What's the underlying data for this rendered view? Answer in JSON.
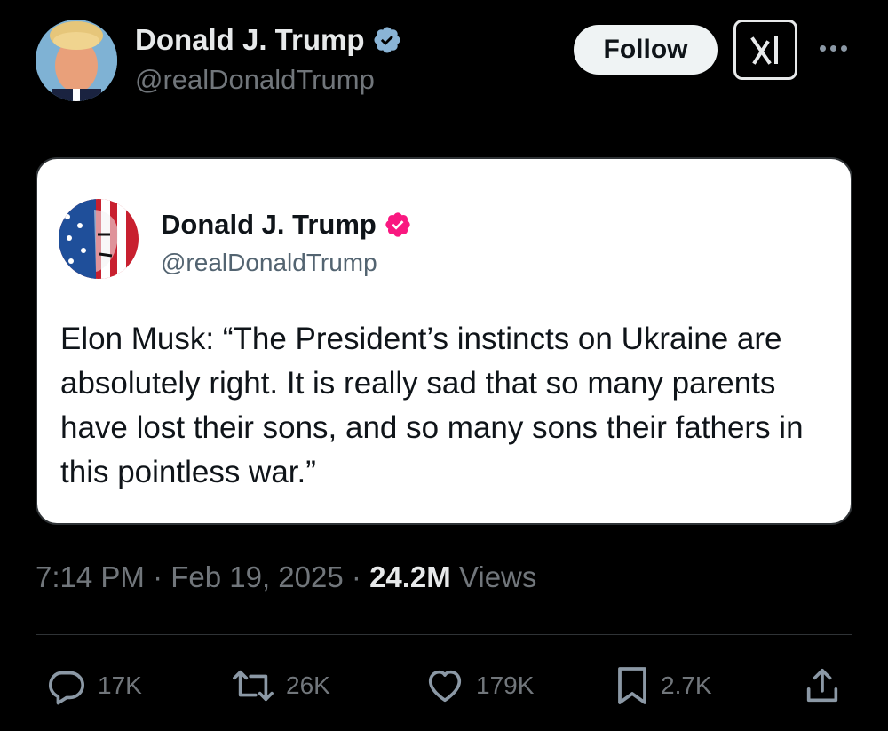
{
  "author": {
    "name": "Donald J. Trump",
    "handle": "@realDonaldTrump",
    "verified_color": "#8ab4d6"
  },
  "header": {
    "follow_label": "Follow",
    "grok_icon": "grok-icon",
    "more_icon": "more-icon"
  },
  "quoted_post": {
    "name": "Donald J. Trump",
    "handle": "@realDonaldTrump",
    "verified_color": "#f91880",
    "text": "Elon Musk: “The President’s instincts on Ukraine are absolutely right. It is really sad that so many parents have lost their sons, and so many sons their fathers in this pointless war.”"
  },
  "meta": {
    "time": "7:14 PM",
    "separator": " · ",
    "date": "Feb 19, 2025",
    "views_count": "24.2M",
    "views_label": "Views"
  },
  "actions": {
    "replies": "17K",
    "reposts": "26K",
    "likes": "179K",
    "bookmarks": "2.7K"
  },
  "colors": {
    "background": "#000000",
    "text_primary": "#e7e9ea",
    "text_secondary": "#71767b",
    "card_background": "#ffffff"
  }
}
